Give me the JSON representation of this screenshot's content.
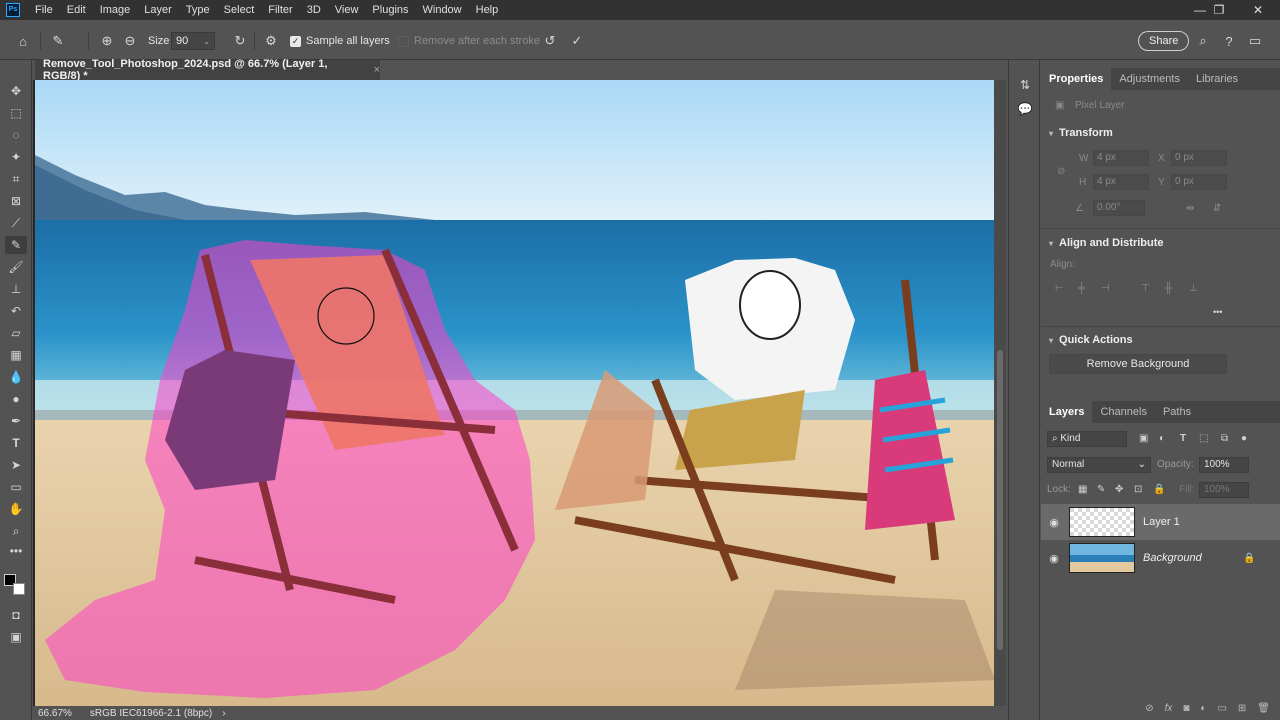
{
  "app": {
    "logo": "Ps",
    "menu": [
      "File",
      "Edit",
      "Image",
      "Layer",
      "Type",
      "Select",
      "Filter",
      "3D",
      "View",
      "Plugins",
      "Window",
      "Help"
    ]
  },
  "options_bar": {
    "size_label": "Size",
    "size_value": "90",
    "sample_all_layers_label": "Sample all layers",
    "sample_all_layers_checked": true,
    "remove_after_stroke_label": "Remove after each stroke",
    "remove_after_stroke_checked": false,
    "share_label": "Share"
  },
  "document": {
    "tab_title": "Remove_Tool_Photoshop_2024.psd @ 66.7% (Layer 1, RGB/8) *",
    "close_glyph": "×"
  },
  "status": {
    "zoom": "66.67%",
    "profile": "sRGB IEC61966-2.1 (8bpc)",
    "arrow": "›"
  },
  "panels": {
    "top_tabs": [
      "Properties",
      "Adjustments",
      "Libraries"
    ],
    "pixel_layer_label": "Pixel Layer",
    "transform": {
      "title": "Transform",
      "w_label": "W",
      "w_value": "4 px",
      "h_label": "H",
      "h_value": "4 px",
      "x_label": "X",
      "x_value": "0 px",
      "y_label": "Y",
      "y_value": "0 px",
      "angle_value": "0.00°"
    },
    "align": {
      "title": "Align and Distribute",
      "align_label": "Align:",
      "more": "•••"
    },
    "quick_actions": {
      "title": "Quick Actions",
      "remove_bg_label": "Remove Background"
    },
    "layers_tabs": [
      "Layers",
      "Channels",
      "Paths"
    ],
    "kind_label": "Kind",
    "blend_mode": "Normal",
    "opacity_label": "Opacity:",
    "opacity_value": "100%",
    "lock_label": "Lock:",
    "fill_label": "Fill:",
    "fill_value": "100%",
    "layers": [
      {
        "name": "Layer 1",
        "selected": true,
        "italic": false
      },
      {
        "name": "Background",
        "selected": false,
        "italic": true
      }
    ]
  },
  "colors": {
    "app_bg": "#535353",
    "menubar": "#323232",
    "accent": "#31a8ff",
    "selection_overlay": "#ff40c8"
  }
}
